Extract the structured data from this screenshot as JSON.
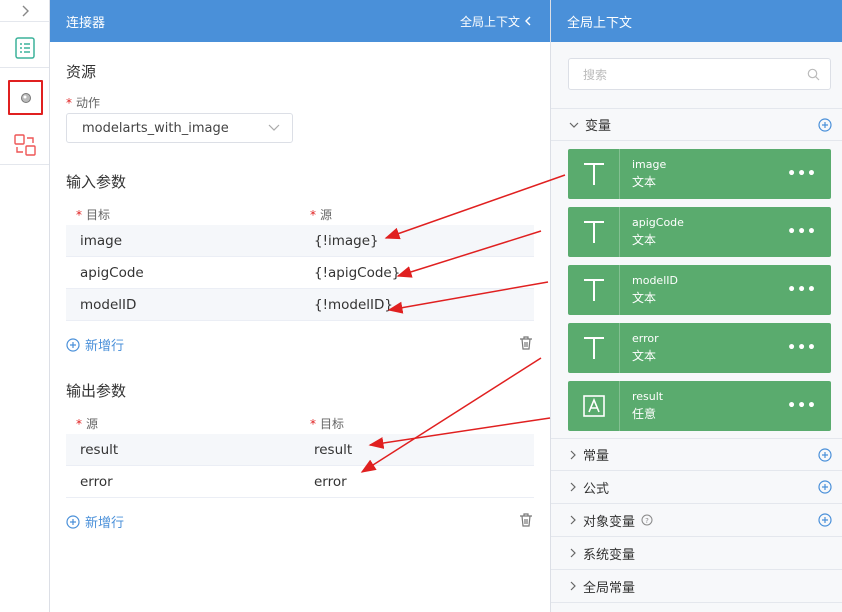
{
  "center": {
    "header_title": "连接器",
    "header_context": "全局上下文",
    "resource_title": "资源",
    "action_label": "动作",
    "action_value": "modelarts_with_image",
    "input_title": "输入参数",
    "input_head": {
      "target": "目标",
      "source": "源"
    },
    "inputs": [
      {
        "name": "image",
        "value": "{!image}"
      },
      {
        "name": "apigCode",
        "value": "{!apigCode}"
      },
      {
        "name": "modelID",
        "value": "{!modelID}"
      }
    ],
    "add_row": "新增行",
    "output_title": "输出参数",
    "output_head": {
      "source": "源",
      "target": "目标"
    },
    "outputs": [
      {
        "source": "result",
        "target": "result"
      },
      {
        "source": "error",
        "target": "error"
      }
    ]
  },
  "right": {
    "title": "全局上下文",
    "search_placeholder": "搜索",
    "variables_label": "变量",
    "variables": [
      {
        "name": "image",
        "type": "文本",
        "icon": "text-icon"
      },
      {
        "name": "apigCode",
        "type": "文本",
        "icon": "text-icon"
      },
      {
        "name": "modelID",
        "type": "文本",
        "icon": "text-icon"
      },
      {
        "name": "error",
        "type": "文本",
        "icon": "text-icon"
      },
      {
        "name": "result",
        "type": "任意",
        "icon": "any-icon"
      }
    ],
    "groups": [
      "常量",
      "公式",
      "对象变量",
      "系统变量",
      "全局常量"
    ]
  },
  "colors": {
    "header": "#4a90d9",
    "card": "#5aab6e",
    "arrow": "#e02020",
    "required": "#e02020"
  }
}
